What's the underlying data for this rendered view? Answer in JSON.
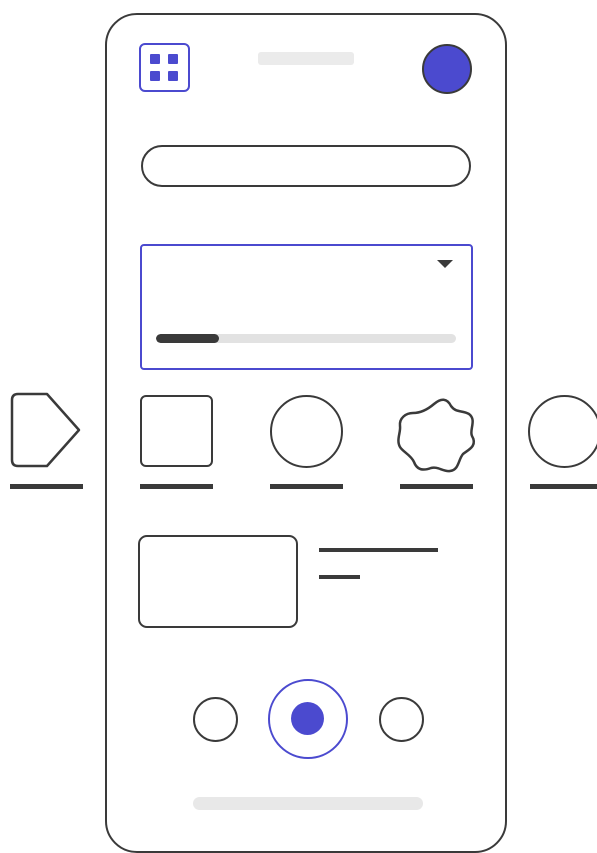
{
  "colors": {
    "accent": "#4b4acf",
    "stroke": "#3a3a3a",
    "placeholder": "#ebebeb",
    "track": "#e2e2e2"
  },
  "header": {
    "menu_icon": "grid-icon",
    "avatar_icon": "avatar"
  },
  "dropdown": {
    "icon": "caret-down-icon",
    "progress": 0.21
  },
  "carousel": {
    "items": [
      {
        "icon": "pentagon-arrow-icon"
      },
      {
        "icon": "square-icon"
      },
      {
        "icon": "circle-icon"
      },
      {
        "icon": "blob-icon"
      },
      {
        "icon": "circle-icon"
      }
    ]
  },
  "pager": {
    "dots": 3,
    "active_index": 1
  }
}
